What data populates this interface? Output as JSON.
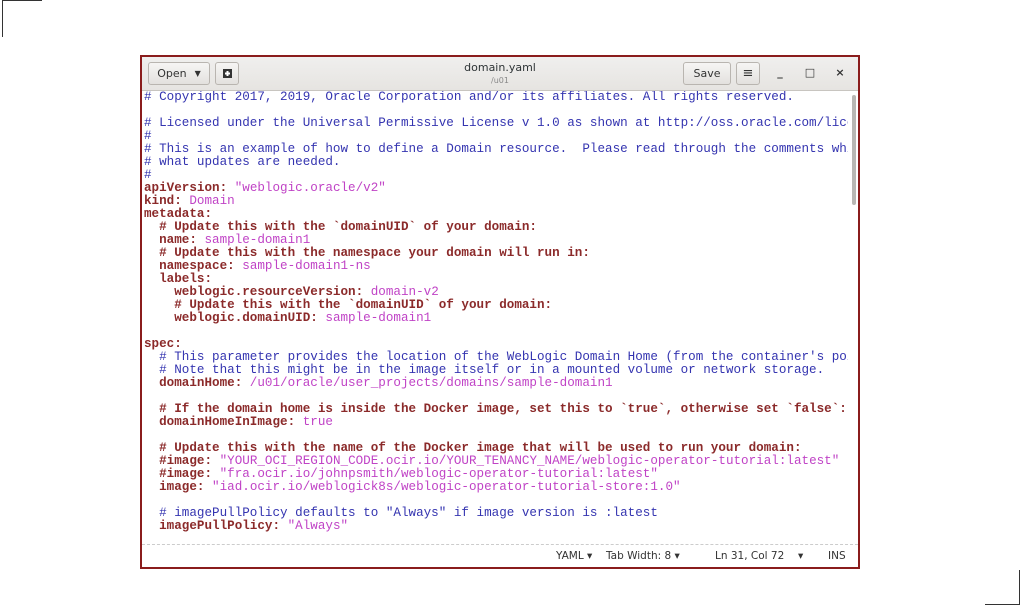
{
  "header": {
    "open_label": "Open",
    "title": "domain.yaml",
    "subtitle": "/u01",
    "save_label": "Save"
  },
  "status": {
    "language": "YAML",
    "tab_width": "Tab Width: 8",
    "position": "Ln 31, Col 72",
    "mode": "INS"
  },
  "lines": [
    [
      [
        "cb",
        "# Copyright 2017, 2019, Oracle Corporation and/or its affiliates. All rights reserved."
      ]
    ],
    [],
    [
      [
        "cb",
        "# Licensed under the Universal Permissive License v 1.0 as shown at http://oss.oracle.com/licenses/upl."
      ]
    ],
    [
      [
        "cb",
        "#"
      ]
    ],
    [
      [
        "cb",
        "# This is an example of how to define a Domain resource.  Please read through the comments which explain"
      ]
    ],
    [
      [
        "cb",
        "# what updates are needed."
      ]
    ],
    [
      [
        "cb",
        "#"
      ]
    ],
    [
      [
        "k",
        "apiVersion:"
      ],
      [
        "v",
        " \"weblogic.oracle/v2\""
      ]
    ],
    [
      [
        "k",
        "kind:"
      ],
      [
        "v",
        " Domain"
      ]
    ],
    [
      [
        "k",
        "metadata:"
      ]
    ],
    [
      [
        "cr",
        "  # Update this with the `domainUID` of your domain:"
      ]
    ],
    [
      [
        "k",
        "  name:"
      ],
      [
        "v",
        " sample-domain1"
      ]
    ],
    [
      [
        "cr",
        "  # Update this with the namespace your domain will run in:"
      ]
    ],
    [
      [
        "k",
        "  namespace:"
      ],
      [
        "v",
        " sample-domain1-ns"
      ]
    ],
    [
      [
        "k",
        "  labels:"
      ]
    ],
    [
      [
        "k",
        "    weblogic.resourceVersion:"
      ],
      [
        "v",
        " domain-v2"
      ]
    ],
    [
      [
        "cr",
        "    # Update this with the `domainUID` of your domain:"
      ]
    ],
    [
      [
        "k",
        "    weblogic.domainUID:"
      ],
      [
        "v",
        " sample-domain1"
      ]
    ],
    [],
    [
      [
        "k",
        "spec:"
      ]
    ],
    [
      [
        "cb",
        "  # This parameter provides the location of the WebLogic Domain Home (from the container's point of view)."
      ]
    ],
    [
      [
        "cb",
        "  # Note that this might be in the image itself or in a mounted volume or network storage."
      ]
    ],
    [
      [
        "k",
        "  domainHome:"
      ],
      [
        "v",
        " /u01/oracle/user_projects/domains/sample-domain1"
      ]
    ],
    [],
    [
      [
        "cr",
        "  # If the domain home is inside the Docker image, set this to `true`, otherwise set `false`:"
      ]
    ],
    [
      [
        "k",
        "  domainHomeInImage:"
      ],
      [
        "v",
        " true"
      ]
    ],
    [],
    [
      [
        "cr",
        "  # Update this with the name of the Docker image that will be used to run your domain:"
      ]
    ],
    [
      [
        "k",
        "  #image:"
      ],
      [
        "v",
        " \"YOUR_OCI_REGION_CODE.ocir.io/YOUR_TENANCY_NAME/weblogic-operator-tutorial:latest\""
      ]
    ],
    [
      [
        "k",
        "  #image:"
      ],
      [
        "v",
        " \"fra.ocir.io/johnpsmith/weblogic-operator-tutorial:latest\""
      ]
    ],
    [
      [
        "k",
        "  image:"
      ],
      [
        "v",
        " \"iad.ocir.io/weblogick8s/weblogic-operator-tutorial-store:1.0\""
      ]
    ],
    [],
    [
      [
        "cb",
        "  # imagePullPolicy defaults to \"Always\" if image version is :latest"
      ]
    ],
    [
      [
        "k",
        "  imagePullPolicy:"
      ],
      [
        "v",
        " \"Always\""
      ]
    ]
  ]
}
